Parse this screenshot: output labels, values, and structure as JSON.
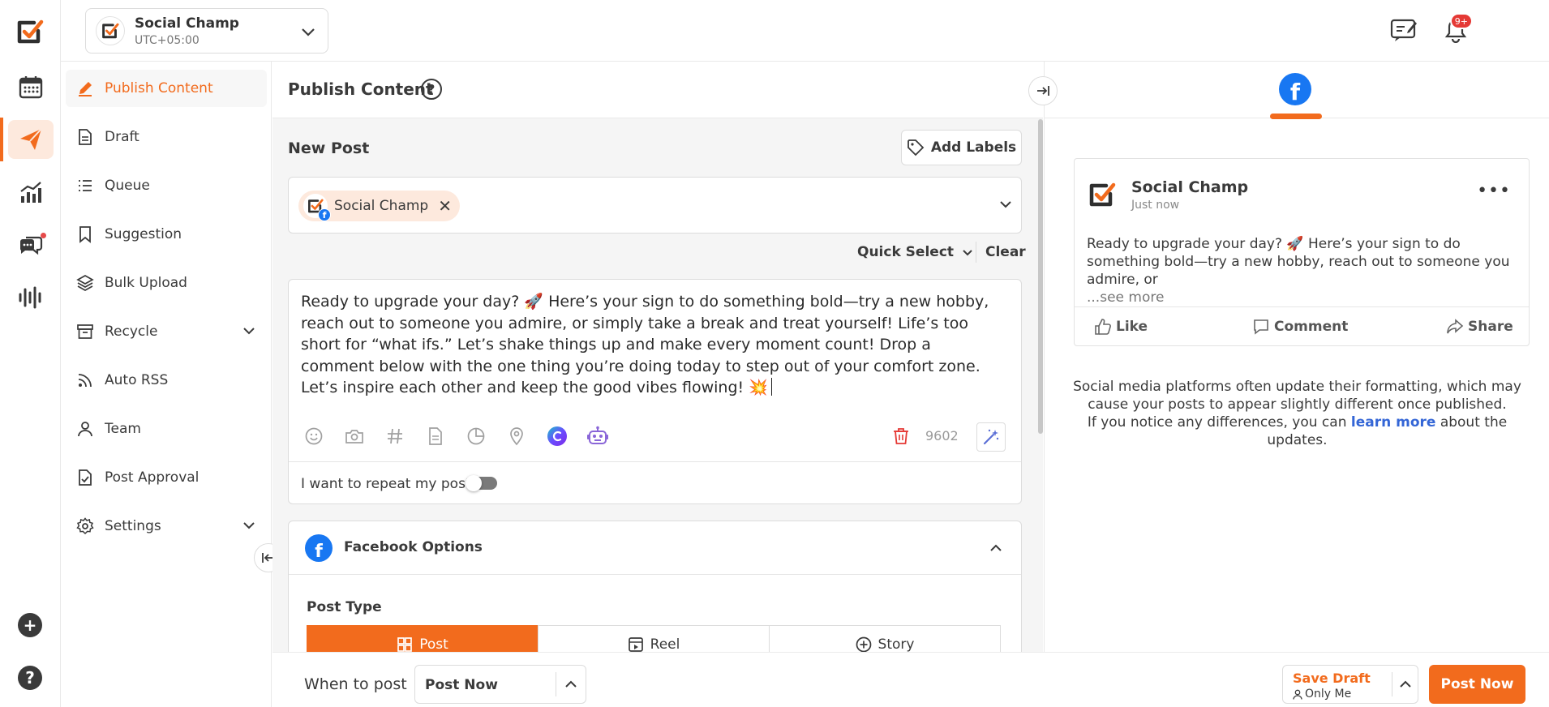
{
  "rail": {
    "items": [
      "calendar-icon",
      "send-icon",
      "analytics-icon",
      "chat-icon",
      "audio-icon"
    ],
    "active": "send-icon",
    "bottom": [
      "add-icon",
      "help-icon"
    ]
  },
  "topbar": {
    "account_name": "Social Champ",
    "account_tz": "UTC+05:00",
    "notification_count": "9+"
  },
  "menu": {
    "items": [
      {
        "label": "Publish Content",
        "icon": "pencil-icon"
      },
      {
        "label": "Draft",
        "icon": "document-icon"
      },
      {
        "label": "Queue",
        "icon": "list-icon"
      },
      {
        "label": "Suggestion",
        "icon": "bookmark-icon"
      },
      {
        "label": "Bulk Upload",
        "icon": "layers-icon"
      },
      {
        "label": "Recycle",
        "icon": "archive-icon"
      },
      {
        "label": "Auto RSS",
        "icon": "rss-icon"
      },
      {
        "label": "Team",
        "icon": "user-icon"
      },
      {
        "label": "Post Approval",
        "icon": "approval-doc-icon"
      },
      {
        "label": "Settings",
        "icon": "gear-icon"
      }
    ]
  },
  "composer": {
    "title": "Publish Content",
    "help": "?",
    "new_post": "New Post",
    "add_labels": "Add Labels",
    "selected_account": "Social Champ",
    "quick_select": "Quick Select",
    "clear": "Clear",
    "post_text": "Ready to upgrade your day? 🚀 Here’s your sign to do something bold—try a new hobby, reach out to someone you admire, or simply take a break and treat yourself! Life’s too short for “what ifs.” Let’s shake things up and make every moment count! Drop a comment below with the one thing you’re doing today to step out of your comfort zone. Let’s inspire each other and keep the good vibes flowing! 💥",
    "char_count": "9602",
    "repeat_label": "I want to repeat my post",
    "repeat_enabled": false
  },
  "facebook_options": {
    "title": "Facebook Options",
    "post_type_label": "Post Type",
    "post_types": [
      "Post",
      "Reel",
      "Story"
    ],
    "selected_post_type": "Post"
  },
  "bottombar": {
    "when_label": "When to post",
    "when_value": "Post Now",
    "save_draft": "Save Draft",
    "save_draft_visibility": "Only Me",
    "post_now": "Post Now"
  },
  "preview": {
    "account_name": "Social Champ",
    "timestamp": "Just now",
    "text": "Ready to upgrade your day? 🚀 Here’s your sign to do something bold—try a new hobby, reach out to someone you admire, or",
    "see_more": "...see more",
    "actions": [
      "Like",
      "Comment",
      "Share"
    ],
    "note_line1": "Social media platforms often update their formatting, which may cause your posts to appear slightly different once published.",
    "note_line2_prefix": "If you notice any differences, you can ",
    "note_link": "learn more",
    "note_line2_suffix": " about the updates."
  },
  "colors": {
    "brand": "#f26b1d",
    "facebook": "#1877f2",
    "link": "#3466d6",
    "badge": "#e53935"
  }
}
